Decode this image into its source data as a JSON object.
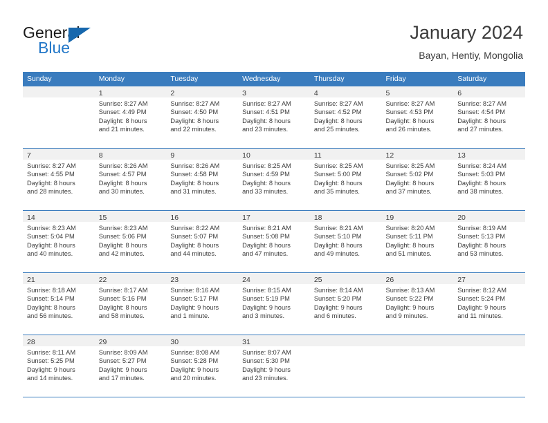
{
  "brand": {
    "word1": "General",
    "word2": "Blue",
    "triangle_color": "#1667ad",
    "blue_color": "#2277c8",
    "logo_icon": "general-blue-logo-icon"
  },
  "header": {
    "title": "January 2024",
    "location": "Bayan, Hentiy, Mongolia"
  },
  "theme": {
    "header_blue": "#3a7cbe",
    "daynum_band": "#f1f1f1",
    "text": "#3b3b3b"
  },
  "weekdays": [
    "Sunday",
    "Monday",
    "Tuesday",
    "Wednesday",
    "Thursday",
    "Friday",
    "Saturday"
  ],
  "weeks": [
    [
      {
        "day": "",
        "sunrise": "",
        "sunset": "",
        "daylight_line1": "",
        "daylight_line2": ""
      },
      {
        "day": "1",
        "sunrise": "Sunrise: 8:27 AM",
        "sunset": "Sunset: 4:49 PM",
        "daylight_line1": "Daylight: 8 hours",
        "daylight_line2": "and 21 minutes."
      },
      {
        "day": "2",
        "sunrise": "Sunrise: 8:27 AM",
        "sunset": "Sunset: 4:50 PM",
        "daylight_line1": "Daylight: 8 hours",
        "daylight_line2": "and 22 minutes."
      },
      {
        "day": "3",
        "sunrise": "Sunrise: 8:27 AM",
        "sunset": "Sunset: 4:51 PM",
        "daylight_line1": "Daylight: 8 hours",
        "daylight_line2": "and 23 minutes."
      },
      {
        "day": "4",
        "sunrise": "Sunrise: 8:27 AM",
        "sunset": "Sunset: 4:52 PM",
        "daylight_line1": "Daylight: 8 hours",
        "daylight_line2": "and 25 minutes."
      },
      {
        "day": "5",
        "sunrise": "Sunrise: 8:27 AM",
        "sunset": "Sunset: 4:53 PM",
        "daylight_line1": "Daylight: 8 hours",
        "daylight_line2": "and 26 minutes."
      },
      {
        "day": "6",
        "sunrise": "Sunrise: 8:27 AM",
        "sunset": "Sunset: 4:54 PM",
        "daylight_line1": "Daylight: 8 hours",
        "daylight_line2": "and 27 minutes."
      }
    ],
    [
      {
        "day": "7",
        "sunrise": "Sunrise: 8:27 AM",
        "sunset": "Sunset: 4:55 PM",
        "daylight_line1": "Daylight: 8 hours",
        "daylight_line2": "and 28 minutes."
      },
      {
        "day": "8",
        "sunrise": "Sunrise: 8:26 AM",
        "sunset": "Sunset: 4:57 PM",
        "daylight_line1": "Daylight: 8 hours",
        "daylight_line2": "and 30 minutes."
      },
      {
        "day": "9",
        "sunrise": "Sunrise: 8:26 AM",
        "sunset": "Sunset: 4:58 PM",
        "daylight_line1": "Daylight: 8 hours",
        "daylight_line2": "and 31 minutes."
      },
      {
        "day": "10",
        "sunrise": "Sunrise: 8:25 AM",
        "sunset": "Sunset: 4:59 PM",
        "daylight_line1": "Daylight: 8 hours",
        "daylight_line2": "and 33 minutes."
      },
      {
        "day": "11",
        "sunrise": "Sunrise: 8:25 AM",
        "sunset": "Sunset: 5:00 PM",
        "daylight_line1": "Daylight: 8 hours",
        "daylight_line2": "and 35 minutes."
      },
      {
        "day": "12",
        "sunrise": "Sunrise: 8:25 AM",
        "sunset": "Sunset: 5:02 PM",
        "daylight_line1": "Daylight: 8 hours",
        "daylight_line2": "and 37 minutes."
      },
      {
        "day": "13",
        "sunrise": "Sunrise: 8:24 AM",
        "sunset": "Sunset: 5:03 PM",
        "daylight_line1": "Daylight: 8 hours",
        "daylight_line2": "and 38 minutes."
      }
    ],
    [
      {
        "day": "14",
        "sunrise": "Sunrise: 8:23 AM",
        "sunset": "Sunset: 5:04 PM",
        "daylight_line1": "Daylight: 8 hours",
        "daylight_line2": "and 40 minutes."
      },
      {
        "day": "15",
        "sunrise": "Sunrise: 8:23 AM",
        "sunset": "Sunset: 5:06 PM",
        "daylight_line1": "Daylight: 8 hours",
        "daylight_line2": "and 42 minutes."
      },
      {
        "day": "16",
        "sunrise": "Sunrise: 8:22 AM",
        "sunset": "Sunset: 5:07 PM",
        "daylight_line1": "Daylight: 8 hours",
        "daylight_line2": "and 44 minutes."
      },
      {
        "day": "17",
        "sunrise": "Sunrise: 8:21 AM",
        "sunset": "Sunset: 5:08 PM",
        "daylight_line1": "Daylight: 8 hours",
        "daylight_line2": "and 47 minutes."
      },
      {
        "day": "18",
        "sunrise": "Sunrise: 8:21 AM",
        "sunset": "Sunset: 5:10 PM",
        "daylight_line1": "Daylight: 8 hours",
        "daylight_line2": "and 49 minutes."
      },
      {
        "day": "19",
        "sunrise": "Sunrise: 8:20 AM",
        "sunset": "Sunset: 5:11 PM",
        "daylight_line1": "Daylight: 8 hours",
        "daylight_line2": "and 51 minutes."
      },
      {
        "day": "20",
        "sunrise": "Sunrise: 8:19 AM",
        "sunset": "Sunset: 5:13 PM",
        "daylight_line1": "Daylight: 8 hours",
        "daylight_line2": "and 53 minutes."
      }
    ],
    [
      {
        "day": "21",
        "sunrise": "Sunrise: 8:18 AM",
        "sunset": "Sunset: 5:14 PM",
        "daylight_line1": "Daylight: 8 hours",
        "daylight_line2": "and 56 minutes."
      },
      {
        "day": "22",
        "sunrise": "Sunrise: 8:17 AM",
        "sunset": "Sunset: 5:16 PM",
        "daylight_line1": "Daylight: 8 hours",
        "daylight_line2": "and 58 minutes."
      },
      {
        "day": "23",
        "sunrise": "Sunrise: 8:16 AM",
        "sunset": "Sunset: 5:17 PM",
        "daylight_line1": "Daylight: 9 hours",
        "daylight_line2": "and 1 minute."
      },
      {
        "day": "24",
        "sunrise": "Sunrise: 8:15 AM",
        "sunset": "Sunset: 5:19 PM",
        "daylight_line1": "Daylight: 9 hours",
        "daylight_line2": "and 3 minutes."
      },
      {
        "day": "25",
        "sunrise": "Sunrise: 8:14 AM",
        "sunset": "Sunset: 5:20 PM",
        "daylight_line1": "Daylight: 9 hours",
        "daylight_line2": "and 6 minutes."
      },
      {
        "day": "26",
        "sunrise": "Sunrise: 8:13 AM",
        "sunset": "Sunset: 5:22 PM",
        "daylight_line1": "Daylight: 9 hours",
        "daylight_line2": "and 9 minutes."
      },
      {
        "day": "27",
        "sunrise": "Sunrise: 8:12 AM",
        "sunset": "Sunset: 5:24 PM",
        "daylight_line1": "Daylight: 9 hours",
        "daylight_line2": "and 11 minutes."
      }
    ],
    [
      {
        "day": "28",
        "sunrise": "Sunrise: 8:11 AM",
        "sunset": "Sunset: 5:25 PM",
        "daylight_line1": "Daylight: 9 hours",
        "daylight_line2": "and 14 minutes."
      },
      {
        "day": "29",
        "sunrise": "Sunrise: 8:09 AM",
        "sunset": "Sunset: 5:27 PM",
        "daylight_line1": "Daylight: 9 hours",
        "daylight_line2": "and 17 minutes."
      },
      {
        "day": "30",
        "sunrise": "Sunrise: 8:08 AM",
        "sunset": "Sunset: 5:28 PM",
        "daylight_line1": "Daylight: 9 hours",
        "daylight_line2": "and 20 minutes."
      },
      {
        "day": "31",
        "sunrise": "Sunrise: 8:07 AM",
        "sunset": "Sunset: 5:30 PM",
        "daylight_line1": "Daylight: 9 hours",
        "daylight_line2": "and 23 minutes."
      },
      {
        "day": "",
        "sunrise": "",
        "sunset": "",
        "daylight_line1": "",
        "daylight_line2": ""
      },
      {
        "day": "",
        "sunrise": "",
        "sunset": "",
        "daylight_line1": "",
        "daylight_line2": ""
      },
      {
        "day": "",
        "sunrise": "",
        "sunset": "",
        "daylight_line1": "",
        "daylight_line2": ""
      }
    ]
  ]
}
